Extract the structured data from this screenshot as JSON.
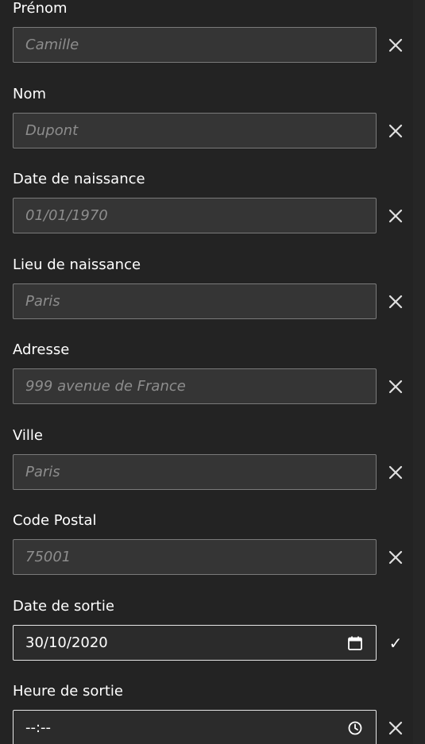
{
  "form": {
    "fields": [
      {
        "label": "Prénom",
        "placeholder": "Camille",
        "status": "clear"
      },
      {
        "label": "Nom",
        "placeholder": "Dupont",
        "status": "clear"
      },
      {
        "label": "Date de naissance",
        "placeholder": "01/01/1970",
        "status": "clear"
      },
      {
        "label": "Lieu de naissance",
        "placeholder": "Paris",
        "status": "clear"
      },
      {
        "label": "Adresse",
        "placeholder": "999 avenue de France",
        "status": "clear"
      },
      {
        "label": "Ville",
        "placeholder": "Paris",
        "status": "clear"
      },
      {
        "label": "Code Postal",
        "placeholder": "75001",
        "status": "clear"
      },
      {
        "label": "Date de sortie",
        "value": "30/10/2020",
        "status": "valid",
        "picker_icon": "calendar-icon"
      },
      {
        "label": "Heure de sortie",
        "value": "--:--",
        "status": "clear",
        "picker_icon": "clock-icon"
      }
    ],
    "colors": {
      "background": "#232323",
      "input_background": "#353535",
      "input_border": "#7a7a7a",
      "text": "#ffffff",
      "placeholder": "#8d8d8d"
    }
  }
}
